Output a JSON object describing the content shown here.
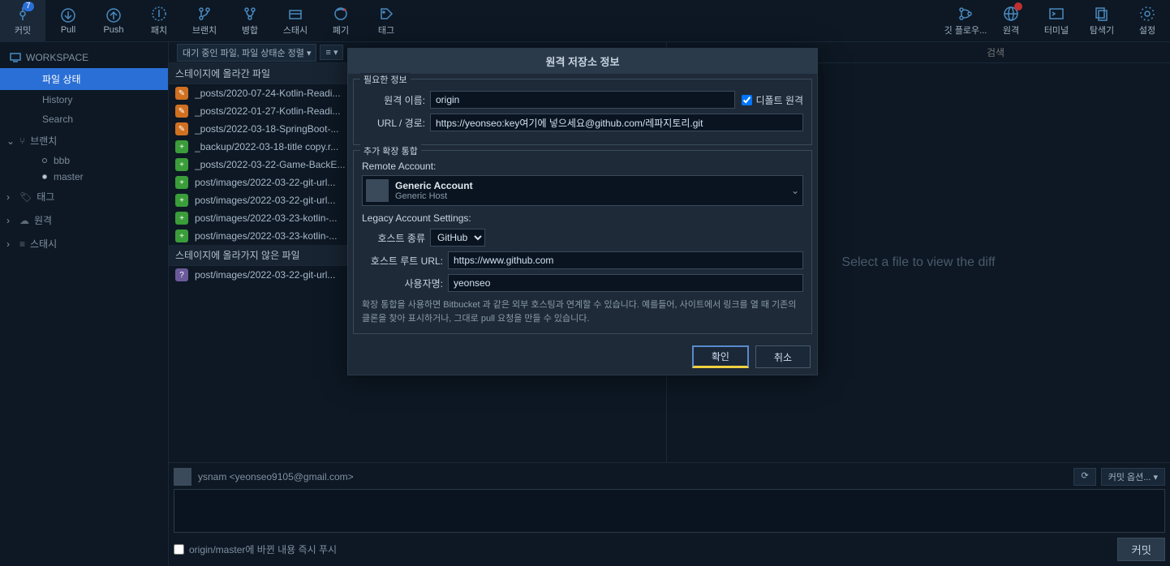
{
  "toolbar": {
    "left": [
      {
        "id": "commit",
        "label": "커밋",
        "badge": "7"
      },
      {
        "id": "pull",
        "label": "Pull"
      },
      {
        "id": "push",
        "label": "Push"
      },
      {
        "id": "patch",
        "label": "패치"
      },
      {
        "id": "branch",
        "label": "브랜치"
      },
      {
        "id": "merge",
        "label": "병합"
      },
      {
        "id": "stash",
        "label": "스태시"
      },
      {
        "id": "discard",
        "label": "폐기"
      },
      {
        "id": "tag",
        "label": "태그"
      }
    ],
    "right": [
      {
        "id": "gitflow",
        "label": "깃 플로우..."
      },
      {
        "id": "remote",
        "label": "원격",
        "redBadge": true
      },
      {
        "id": "terminal",
        "label": "터미널"
      },
      {
        "id": "explorer",
        "label": "탐색기"
      },
      {
        "id": "settings",
        "label": "설정"
      }
    ]
  },
  "sidebar": {
    "workspace_head": "WORKSPACE",
    "workspace_items": [
      {
        "id": "file-status",
        "label": "파일 상태",
        "selected": true
      },
      {
        "id": "history",
        "label": "History"
      },
      {
        "id": "search",
        "label": "Search"
      }
    ],
    "categories": [
      {
        "id": "branches",
        "label": "브랜치",
        "expanded": true,
        "items": [
          {
            "id": "bbb",
            "label": "bbb",
            "current": false
          },
          {
            "id": "master",
            "label": "master",
            "current": true
          }
        ]
      },
      {
        "id": "tags",
        "label": "태그",
        "expanded": false
      },
      {
        "id": "remotes",
        "label": "원격",
        "expanded": false
      },
      {
        "id": "stashes",
        "label": "스태시",
        "expanded": false
      }
    ]
  },
  "filebar": {
    "sort_label": "대기 중인 파일, 파일 상태순 정렬 ▾",
    "view_label": "≡ ▾"
  },
  "staged": {
    "head": "스테이지에 올라간 파일",
    "files": [
      {
        "t": "mod",
        "n": "_posts/2020-07-24-Kotlin-Readi..."
      },
      {
        "t": "mod",
        "n": "_posts/2022-01-27-Kotlin-Readi..."
      },
      {
        "t": "mod",
        "n": "_posts/2022-03-18-SpringBoot-..."
      },
      {
        "t": "add",
        "n": "_backup/2022-03-18-title copy.r..."
      },
      {
        "t": "add",
        "n": "_posts/2022-03-22-Game-BackE..."
      },
      {
        "t": "add",
        "n": "post/images/2022-03-22-git-url..."
      },
      {
        "t": "add",
        "n": "post/images/2022-03-22-git-url..."
      },
      {
        "t": "add",
        "n": "post/images/2022-03-23-kotlin-..."
      },
      {
        "t": "add",
        "n": "post/images/2022-03-23-kotlin-..."
      }
    ]
  },
  "unstaged": {
    "head": "스테이지에 올라가지 않은 파일",
    "files": [
      {
        "t": "unk",
        "n": "post/images/2022-03-22-git-url..."
      }
    ]
  },
  "diff": {
    "search_placeholder": "검색",
    "empty": "Select a file to view the diff"
  },
  "commit": {
    "author": "ysnam <yeonseo9105@gmail.com>",
    "options_label": "커밋 옵션... ▾",
    "push_label": "origin/master에 바뀐 내용 즉시 푸시",
    "button": "커밋"
  },
  "dialog": {
    "title": "원격 저장소 정보",
    "fs1_legend": "필요한 정보",
    "name_label": "원격 이름:",
    "name_value": "origin",
    "default_remote": "디폴트 원격",
    "url_label": "URL / 경로:",
    "url_value": "https://yeonseo:key여기에 넣으세요@github.com/레파지토리.git",
    "fs2_legend": "추가 확장 통합",
    "remote_account_label": "Remote Account:",
    "acct_name": "Generic Account",
    "acct_host": "Generic Host",
    "legacy_label": "Legacy Account Settings:",
    "host_type_label": "호스트 종류",
    "host_type_value": "GitHub",
    "host_root_label": "호스트 루트 URL:",
    "host_root_value": "https://www.github.com",
    "username_label": "사용자명:",
    "username_value": "yeonseo",
    "hint": "확장 통합을 사용하면 Bitbucket 과 같은 외부 호스팅과 연계할 수 있습니다. 예를들어, 사이트에서 링크를 열 때 기존의 클론을 찾아 표시하거나, 그대로 pull 요청을 만들 수 있습니다.",
    "ok": "확인",
    "cancel": "취소"
  }
}
